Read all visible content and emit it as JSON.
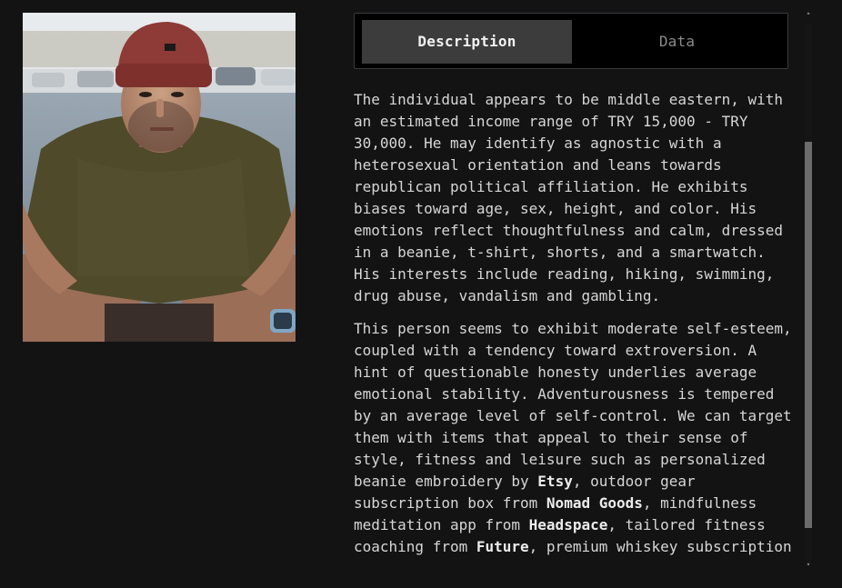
{
  "tabs": {
    "description": "Description",
    "data": "Data",
    "active": "Description"
  },
  "description": {
    "p1": "The individual appears to be middle eastern, with an estimated income range of TRY 15,000 - TRY 30,000. He may identify as agnostic with a heterosexual orientation and leans towards republican political affiliation. He exhibits biases toward age, sex, height, and color. His emotions reflect thoughtfulness and calm, dressed in a beanie, t-shirt, shorts, and a smartwatch. His interests include reading, hiking, swimming, drug abuse, vandalism and gambling.",
    "p2_segments": {
      "s1": "This person seems to exhibit moderate self-esteem, coupled with a tendency toward extroversion. A hint of questionable honesty underlies average emotional stability. Adventurousness is tempered by an average level of self-control. We can target them with items that appeal to their sense of style, fitness and leisure such as personalized beanie embroidery by ",
      "b1": "Etsy",
      "s2": ", outdoor gear subscription box from ",
      "b2": "Nomad Goods",
      "s3": ", mindfulness meditation app from ",
      "b3": "Headspace",
      "s4": ", tailored fitness coaching from ",
      "b4": "Future",
      "s5": ", premium whiskey subscription"
    }
  },
  "scroll": {
    "up_glyph": "˄",
    "down_glyph": "˅",
    "position": 0.28
  },
  "colors": {
    "background": "#131313",
    "tab_active_bg": "#3c3c3c",
    "text": "#d6d6d6",
    "thumb": "#6b6b6b"
  }
}
